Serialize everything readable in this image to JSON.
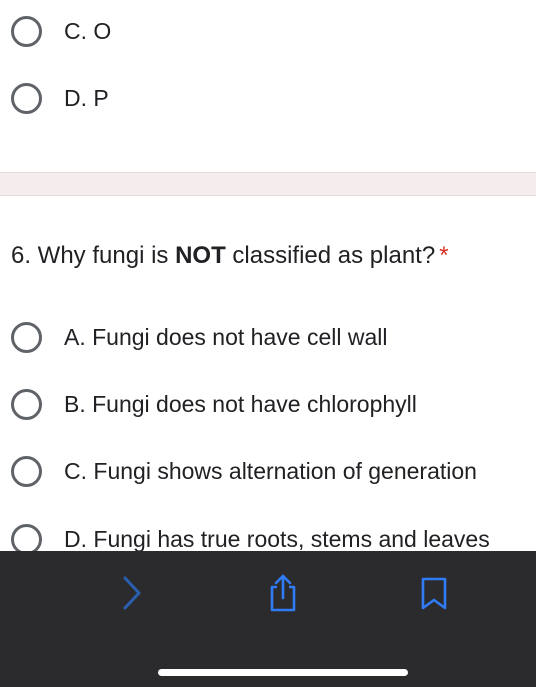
{
  "previous_question": {
    "options": [
      {
        "label": "C. O"
      },
      {
        "label": "D. P"
      }
    ]
  },
  "question": {
    "number_text": "6. Why fungi is ",
    "emphasis": "NOT",
    "rest_text": " classified as plant?",
    "required_mark": "*",
    "options": [
      {
        "label": "A. Fungi does not have cell wall"
      },
      {
        "label": "B. Fungi does not have chlorophyll"
      },
      {
        "label": "C. Fungi shows alternation of generation"
      },
      {
        "label": "D. Fungi has true roots, stems and leaves"
      }
    ]
  },
  "browser_toolbar": {
    "buttons": [
      {
        "icon": "chevron-right-icon",
        "enabled": false
      },
      {
        "icon": "share-icon",
        "enabled": true
      },
      {
        "icon": "bookmark-icon",
        "enabled": true
      }
    ],
    "accent_color": "#2f7cf6",
    "disabled_color": "#2a5fb0"
  }
}
